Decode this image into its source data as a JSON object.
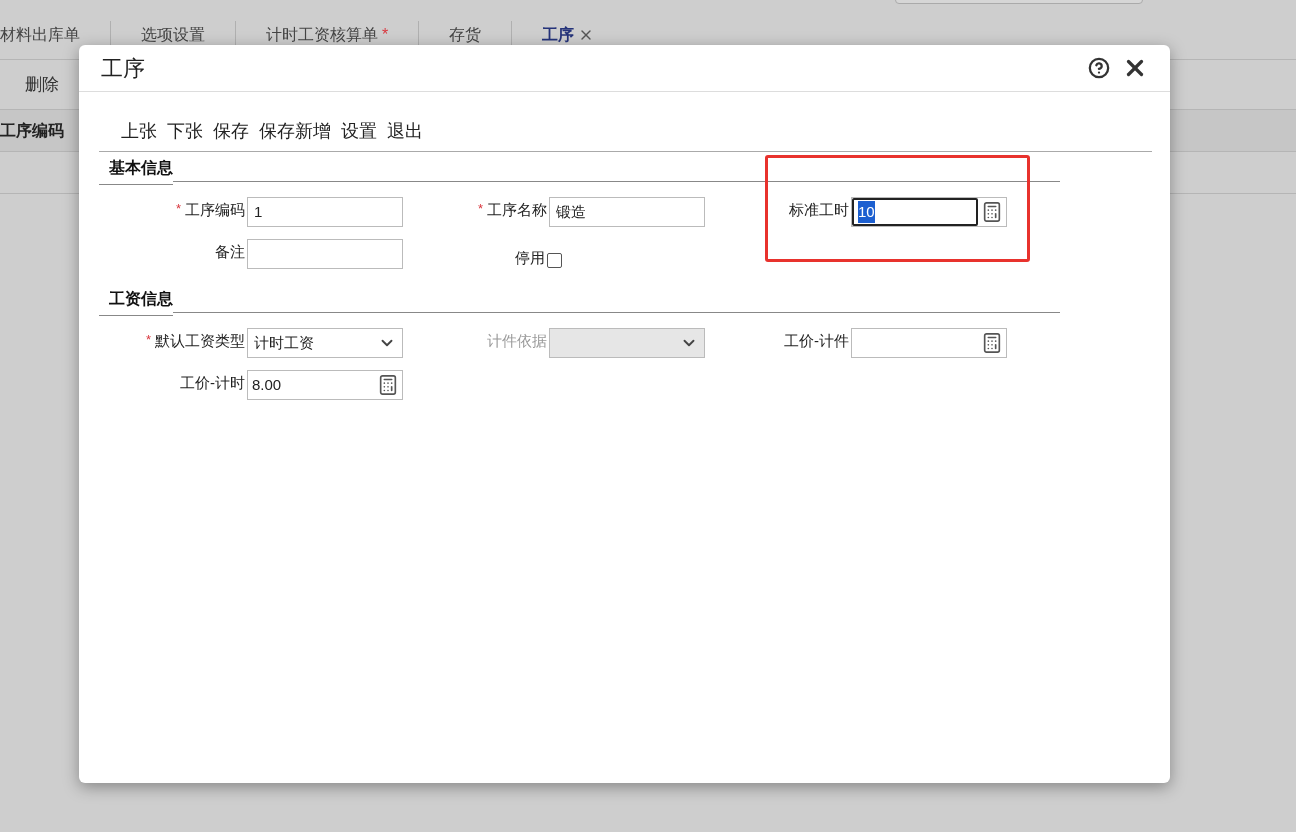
{
  "background": {
    "tabs": [
      {
        "label": "材料出库单",
        "selected": false,
        "closable": false
      },
      {
        "label": "选项设置",
        "selected": false,
        "closable": false
      },
      {
        "label": "计时工资核算单",
        "marker": "*",
        "selected": false,
        "closable": false
      },
      {
        "label": "存货",
        "selected": false,
        "closable": false
      },
      {
        "label": "工序",
        "selected": true,
        "closable": true
      }
    ],
    "toolbar": [
      "删除"
    ],
    "table": {
      "columns": [
        "工序编码"
      ]
    }
  },
  "dialog": {
    "title": "工序",
    "toolbar": [
      "上张",
      "下张",
      "保存",
      "保存新增",
      "设置",
      "退出"
    ],
    "sections": [
      {
        "title": "基本信息",
        "fields": [
          {
            "kind": "text",
            "label": "工序编码",
            "marker": "*",
            "value": "1"
          },
          {
            "kind": "text",
            "label": "工序名称",
            "marker": "*",
            "value": "锻造"
          },
          {
            "kind": "calc",
            "label": "标准工时",
            "value": "10",
            "focused": true,
            "highlighted": true
          },
          {
            "kind": "text",
            "label": "备注"
          },
          {
            "kind": "checkbox",
            "label": "停用",
            "checked": false
          }
        ]
      },
      {
        "title": "工资信息",
        "fields": [
          {
            "kind": "select",
            "label": "默认工资类型",
            "marker": "*",
            "value": "计时工资",
            "disabled": false
          },
          {
            "kind": "select",
            "label": "计件依据",
            "disabled": true
          },
          {
            "kind": "calc",
            "label": "工价-计件"
          },
          {
            "kind": "calc",
            "label": "工价-计时",
            "value": "8.00"
          }
        ]
      }
    ]
  }
}
